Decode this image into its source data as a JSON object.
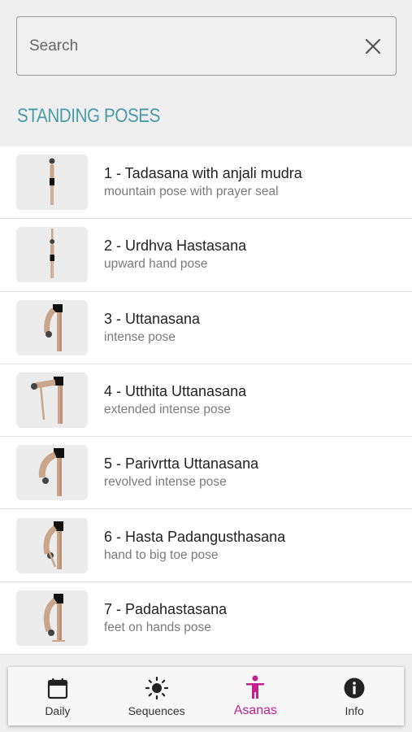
{
  "search": {
    "placeholder": "Search",
    "value": ""
  },
  "section": {
    "heading": "STANDING POSES"
  },
  "poses": [
    {
      "title": "1 - Tadasana with anjali mudra",
      "subtitle": "mountain pose with prayer seal"
    },
    {
      "title": "2 - Urdhva Hastasana",
      "subtitle": "upward hand pose"
    },
    {
      "title": "3 - Uttanasana",
      "subtitle": "intense pose"
    },
    {
      "title": "4 - Utthita Uttanasana",
      "subtitle": "extended intense pose"
    },
    {
      "title": "5 - Parivrtta Uttanasana",
      "subtitle": "revolved intense pose"
    },
    {
      "title": "6 - Hasta Padangusthasana",
      "subtitle": "hand to big toe pose"
    },
    {
      "title": "7 - Padahastasana",
      "subtitle": "feet on hands pose"
    }
  ],
  "nav": {
    "items": [
      {
        "label": "Daily",
        "icon": "calendar-icon"
      },
      {
        "label": "Sequences",
        "icon": "sun-icon"
      },
      {
        "label": "Asanas",
        "icon": "person-icon",
        "active": true
      },
      {
        "label": "Info",
        "icon": "info-icon"
      }
    ]
  },
  "colors": {
    "accent": "#c2218e",
    "heading": "#4a9ba6",
    "background": "#efefef"
  }
}
